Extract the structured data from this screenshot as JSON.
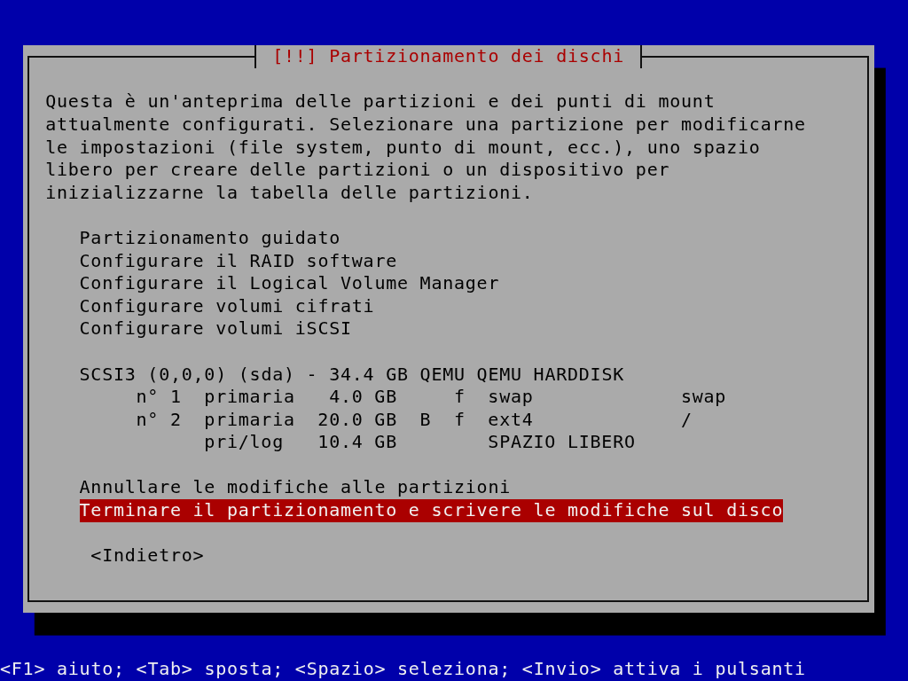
{
  "dialog": {
    "title": "[!!] Partizionamento dei dischi",
    "description": "Questa è un'anteprima delle partizioni e dei punti di mount attualmente configurati. Selezionare una partizione per modificarne le impostazioni (file system, punto di mount, ecc.), uno spazio libero per creare delle partizioni o un dispositivo per inizializzarne la tabella delle partizioni.",
    "menu_sections": [
      {
        "items": [
          {
            "kind": "entry",
            "label": "Partizionamento guidato",
            "selected": false
          },
          {
            "kind": "entry",
            "label": "Configurare il RAID software",
            "selected": false
          },
          {
            "kind": "entry",
            "label": "Configurare il Logical Volume Manager",
            "selected": false
          },
          {
            "kind": "entry",
            "label": "Configurare volumi cifrati",
            "selected": false
          },
          {
            "kind": "entry",
            "label": "Configurare volumi iSCSI",
            "selected": false
          }
        ]
      },
      {
        "items": [
          {
            "kind": "entry",
            "label": "SCSI3 (0,0,0) (sda) - 34.4 GB QEMU QEMU HARDDISK",
            "selected": false
          },
          {
            "kind": "partition",
            "selected": false,
            "column_1": "n° 1",
            "column_2": "primaria",
            "column_3": "4.0 GB",
            "column_5": "f",
            "column_6": "swap",
            "column_7": "swap"
          },
          {
            "kind": "partition",
            "selected": false,
            "column_1": "n° 2",
            "column_2": "primaria",
            "column_3": "20.0 GB",
            "column_4": "B",
            "column_5": "f",
            "column_6": "ext4",
            "column_7": "/"
          },
          {
            "kind": "partition",
            "selected": false,
            "column_2": "pri/log",
            "column_3": "10.4 GB",
            "column_6": "SPAZIO LIBERO"
          }
        ]
      },
      {
        "items": [
          {
            "kind": "entry",
            "label": "Annullare le modifiche alle partizioni",
            "selected": false
          },
          {
            "kind": "entry",
            "label": "Terminare il partizionamento e scrivere le modifiche sul disco",
            "selected": true
          }
        ]
      }
    ],
    "buttons": [
      {
        "label": "<Indietro>",
        "selected": false
      }
    ]
  },
  "status_bar": "<F1> aiuto; <Tab> sposta; <Spazio> seleziona; <Invio> attiva i pulsanti"
}
